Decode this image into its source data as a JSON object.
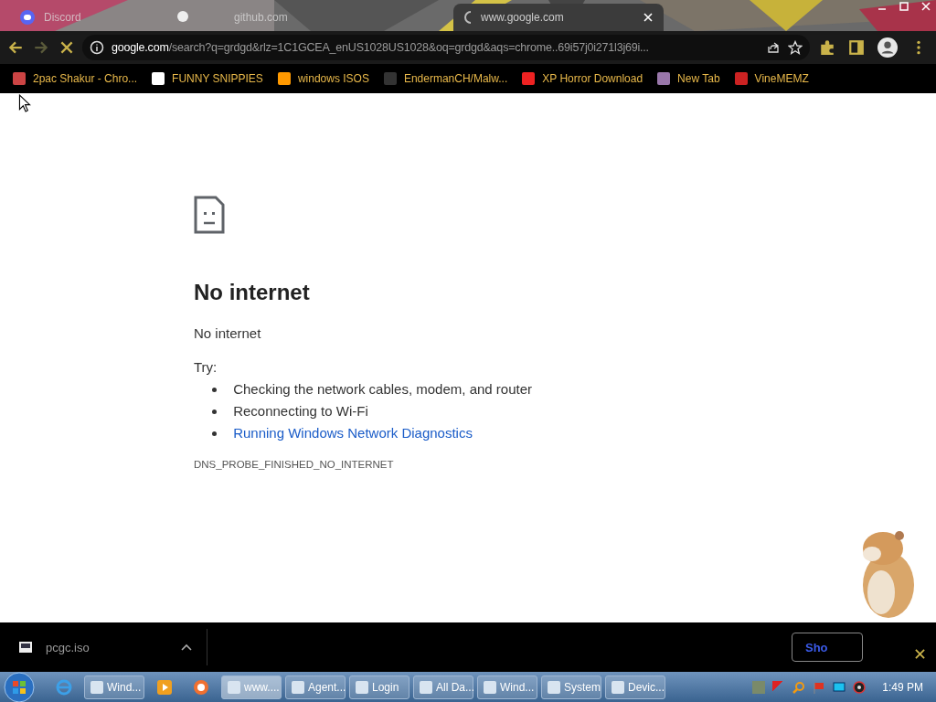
{
  "tabs": [
    {
      "title": "Discord",
      "selected": false,
      "kind": "discord"
    },
    {
      "title": "github.com",
      "selected": false,
      "kind": "plain"
    },
    {
      "title": "www.google.com",
      "selected": true,
      "kind": "loading"
    }
  ],
  "toolbar": {
    "back_disabled": false,
    "forward_disabled": true,
    "url_domain": "google.com",
    "url_rest": "/search?q=grdgd&rlz=1C1GCEA_enUS1028US1028&oq=grdgd&aqs=chrome..69i57j0i271l3j69i..."
  },
  "bookmarks": [
    {
      "label": "2pac Shakur - Chro...",
      "kind": "bag"
    },
    {
      "label": "FUNNY SNIPPIES",
      "kind": "h"
    },
    {
      "label": "windows ISOS",
      "kind": "ph"
    },
    {
      "label": "EndermanCH/Malw...",
      "kind": "yp"
    },
    {
      "label": "XP Horror Download",
      "kind": "x"
    },
    {
      "label": "New Tab",
      "kind": "globe"
    },
    {
      "label": "VineMEMZ",
      "kind": "r"
    }
  ],
  "page": {
    "heading": "No internet",
    "subheading": "No internet",
    "try_label": "Try:",
    "suggestions": [
      {
        "text": "Checking the network cables, modem, and router",
        "kind": "text"
      },
      {
        "text": "Reconnecting to Wi-Fi",
        "kind": "text"
      },
      {
        "text": "Running Windows Network Diagnostics",
        "kind": "link"
      }
    ],
    "error_code": "DNS_PROBE_FINISHED_NO_INTERNET"
  },
  "downloads": {
    "file": "pcgc.iso",
    "button": "Sho"
  },
  "taskbar": {
    "items": [
      {
        "label": "Wind...",
        "selected": false
      },
      {
        "label": "www....",
        "selected": true
      },
      {
        "label": "Agent...",
        "selected": false
      },
      {
        "label": "Login",
        "selected": false
      },
      {
        "label": "All Da...",
        "selected": false
      },
      {
        "label": "Wind...",
        "selected": false
      },
      {
        "label": "System",
        "selected": false
      },
      {
        "label": "Devic...",
        "selected": false
      }
    ],
    "time": "1:49 PM"
  }
}
